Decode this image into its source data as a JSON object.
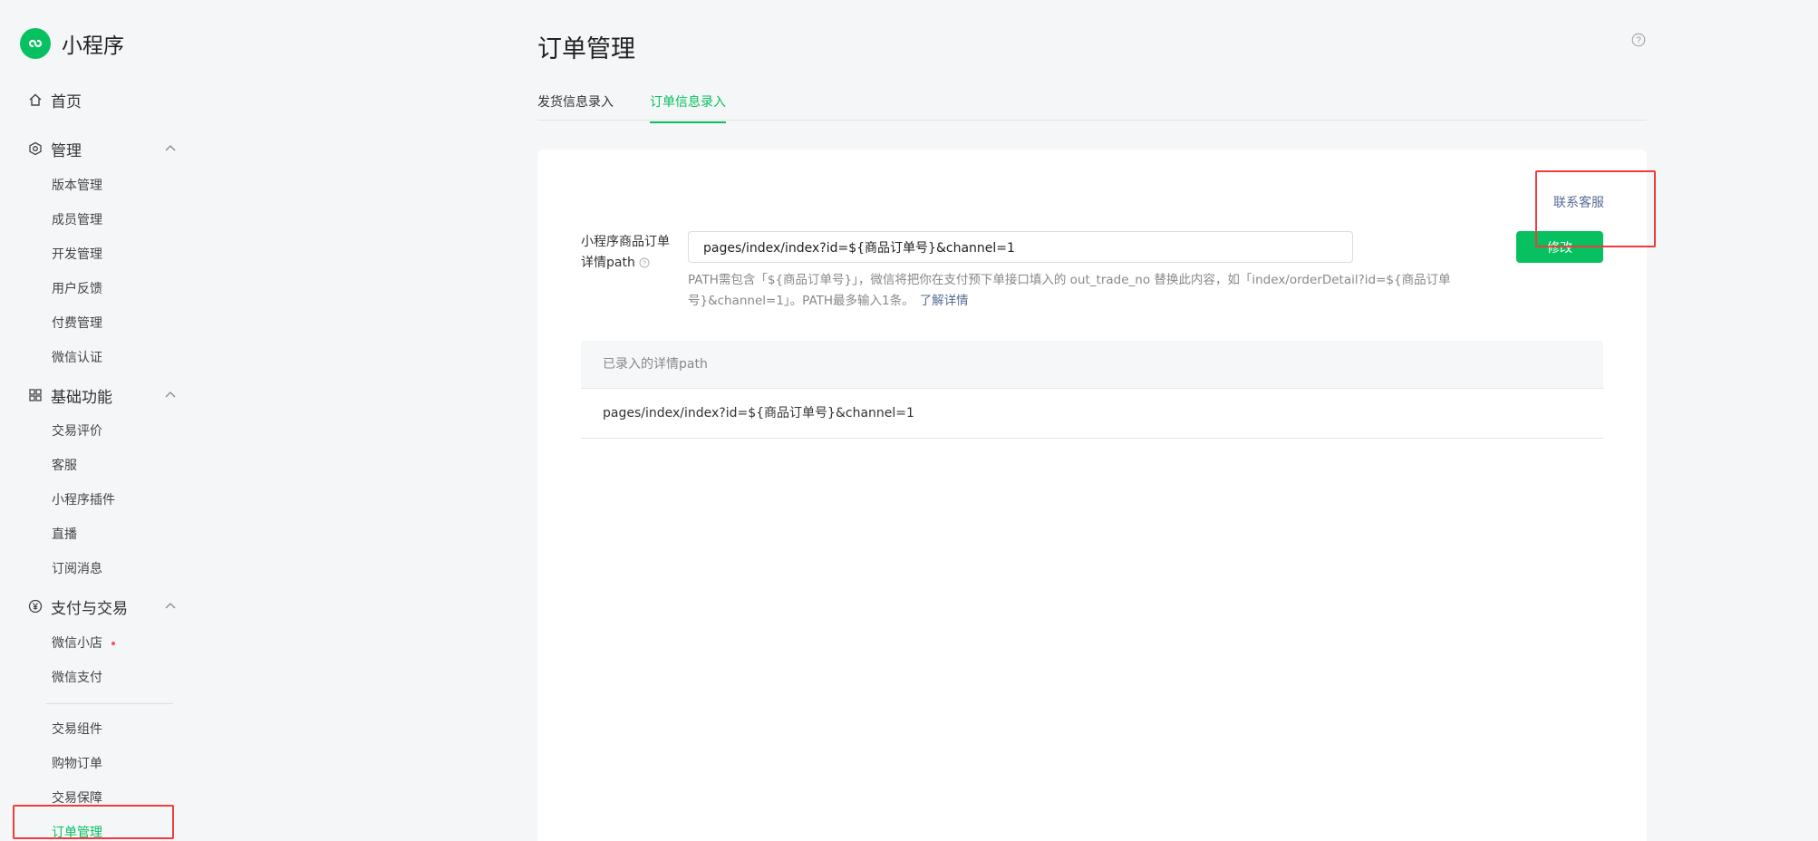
{
  "brand": {
    "name": "小程序"
  },
  "sidebar": {
    "home": "首页",
    "groups": [
      {
        "label": "管理",
        "items": [
          "版本管理",
          "成员管理",
          "开发管理",
          "用户反馈",
          "付费管理",
          "微信认证"
        ]
      },
      {
        "label": "基础功能",
        "items": [
          "交易评价",
          "客服",
          "小程序插件",
          "直播",
          "订阅消息"
        ]
      },
      {
        "label": "支付与交易",
        "items": [
          "微信小店",
          "微信支付"
        ],
        "items_after_divider": [
          "交易组件",
          "购物订单",
          "交易保障",
          "订单管理"
        ]
      }
    ],
    "active_item": "订单管理"
  },
  "page": {
    "title": "订单管理",
    "tabs": [
      "发货信息录入",
      "订单信息录入"
    ],
    "active_tab": "订单信息录入"
  },
  "form": {
    "contact_link": "联系客服",
    "label": "小程序商品订单详情path",
    "input_value": "pages/index/index?id=${商品订单号}&channel=1",
    "hint": "PATH需包含「${商品订单号}」，微信将把你在支付预下单接口填入的 out_trade_no 替换此内容，如「index/orderDetail?id=${商品订单号}&channel=1」。PATH最多输入1条。",
    "hint_link": "了解详情",
    "edit_button": "修改"
  },
  "table": {
    "header": "已录入的详情path",
    "rows": [
      "pages/index/index?id=${商品订单号}&channel=1"
    ]
  },
  "colors": {
    "accent": "#07c160",
    "link": "#576b95",
    "annotation": "#f03c3c"
  }
}
